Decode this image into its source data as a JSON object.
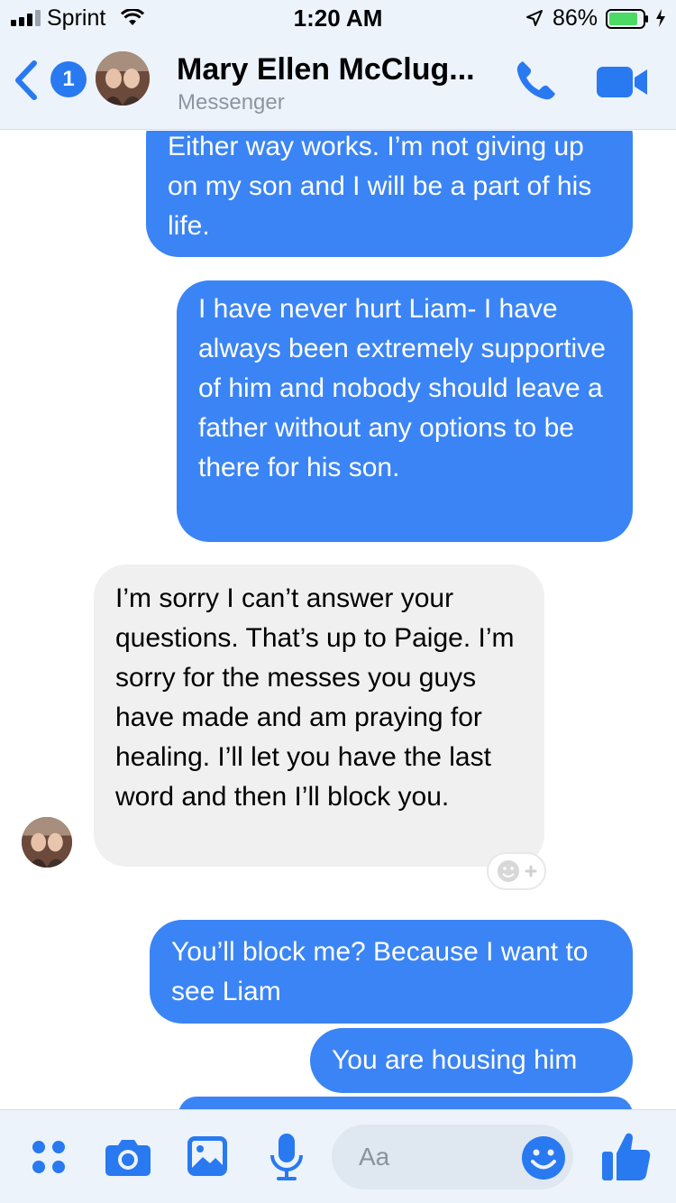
{
  "status_bar": {
    "carrier": "Sprint",
    "time": "1:20 AM",
    "battery_percent": "86%",
    "battery_level": 0.86,
    "signal_icon": "cellular-signal-icon",
    "wifi_icon": "wifi-icon",
    "location_icon": "location-arrow-icon",
    "charging_icon": "bolt-icon"
  },
  "header": {
    "back_badge": "1",
    "title": "Mary Ellen McClug...",
    "subtitle": "Messenger",
    "call_icon": "phone-icon",
    "video_icon": "video-camera-icon"
  },
  "messages": [
    {
      "direction": "outgoing",
      "text": "Either way works. I’m not giving up on my son and I will be a part of his life."
    },
    {
      "direction": "outgoing",
      "text": "I have never hurt Liam- I have always been extremely supportive of him and nobody should leave a father without any options to be there for his son."
    },
    {
      "direction": "incoming",
      "text": "I’m sorry I can’t answer your questions. That’s up to Paige. I’m sorry for the messes you guys have made and am praying for healing. I’ll let you have the last word and then I’ll block you."
    },
    {
      "direction": "outgoing",
      "text": "You’ll block me? Because I want to see Liam"
    },
    {
      "direction": "outgoing",
      "text": "You are housing him"
    }
  ],
  "composer": {
    "placeholder": "Aa",
    "icons": [
      "more-apps-icon",
      "camera-icon",
      "gallery-icon",
      "microphone-icon",
      "emoji-icon",
      "thumbs-up-icon"
    ]
  },
  "colors": {
    "accent": "#2979f1",
    "outgoing_bubble": "#3b84f5",
    "incoming_bubble": "#f0f0f0",
    "battery_fill": "#4cd964",
    "header_bg": "#edf3fb"
  }
}
